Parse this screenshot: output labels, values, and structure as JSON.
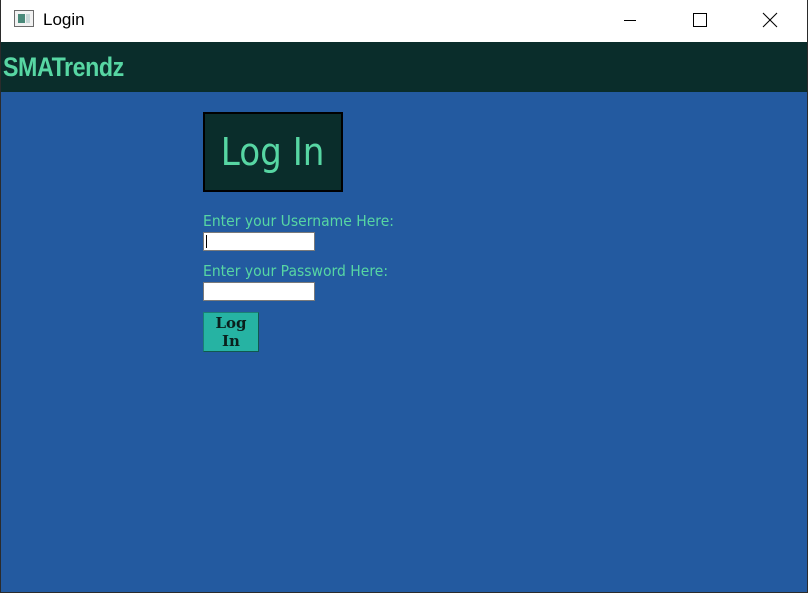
{
  "window": {
    "title": "Login"
  },
  "header": {
    "brand": "SMATrendz"
  },
  "login": {
    "heading": "Log In",
    "username_label": "Enter your Username Here:",
    "username_value": "",
    "password_label": "Enter your Password Here:",
    "password_value": "",
    "submit_label": "Log In"
  },
  "icons": {
    "app": "app-window-icon",
    "minimize": "minimize-icon",
    "maximize": "maximize-icon",
    "close": "close-icon"
  },
  "colors": {
    "background": "#235aa0",
    "header_band": "#0a2d2b",
    "accent_text": "#57d6a3",
    "button": "#26b3a3"
  }
}
